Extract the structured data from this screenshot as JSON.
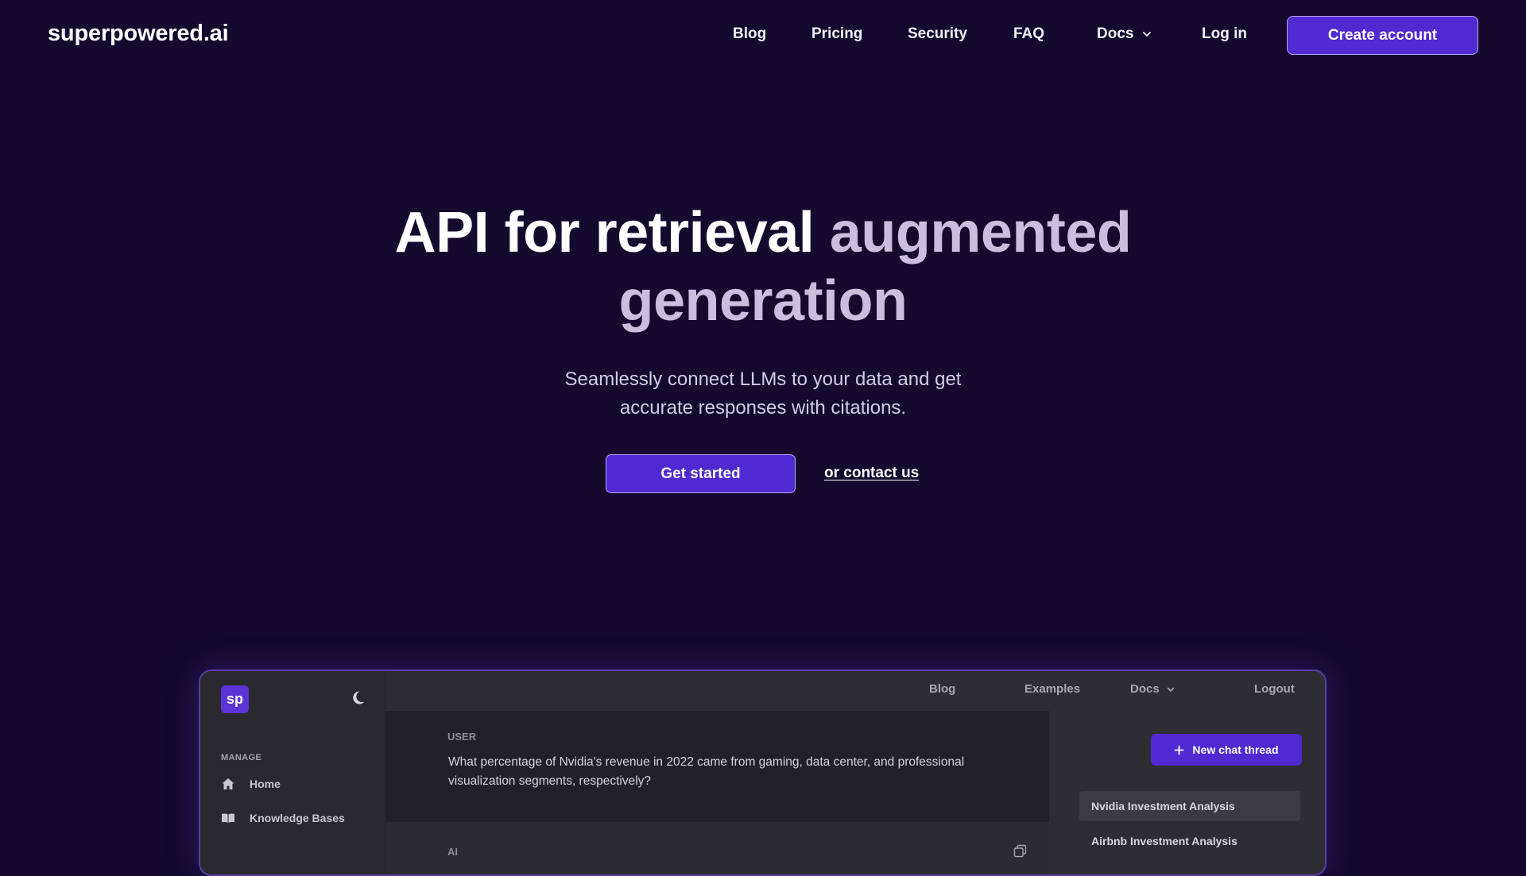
{
  "nav": {
    "brand": "superpowered.ai",
    "links": [
      "Blog",
      "Pricing",
      "Security",
      "FAQ"
    ],
    "docs_label": "Docs",
    "login_label": "Log in",
    "create_account_label": "Create account"
  },
  "hero": {
    "title_part1": "API for retrieval ",
    "title_part2": "augmented",
    "title_part3": "generation",
    "subtitle_line1": "Seamlessly connect LLMs to your data and get",
    "subtitle_line2": "accurate responses with citations.",
    "cta_primary": "Get started",
    "cta_secondary": "or contact us"
  },
  "preview": {
    "logo_text": "sp",
    "sidebar": {
      "section_label": "MANAGE",
      "items": [
        "Home",
        "Knowledge Bases"
      ]
    },
    "topbar": {
      "links": [
        "Blog",
        "Examples"
      ],
      "docs_label": "Docs",
      "logout_label": "Logout"
    },
    "chat": {
      "user_label": "USER",
      "user_message": "What percentage of Nvidia's revenue in 2022 came from gaming, data center, and professional visualization segments, respectively?",
      "ai_label": "AI"
    },
    "threads": {
      "new_thread_label": "New chat thread",
      "items": [
        "Nvidia Investment Analysis",
        "Airbnb Investment Analysis"
      ]
    }
  },
  "colors": {
    "background": "#130a2e",
    "accent": "#4f2ad1",
    "accent_border": "#b9a8ff"
  }
}
